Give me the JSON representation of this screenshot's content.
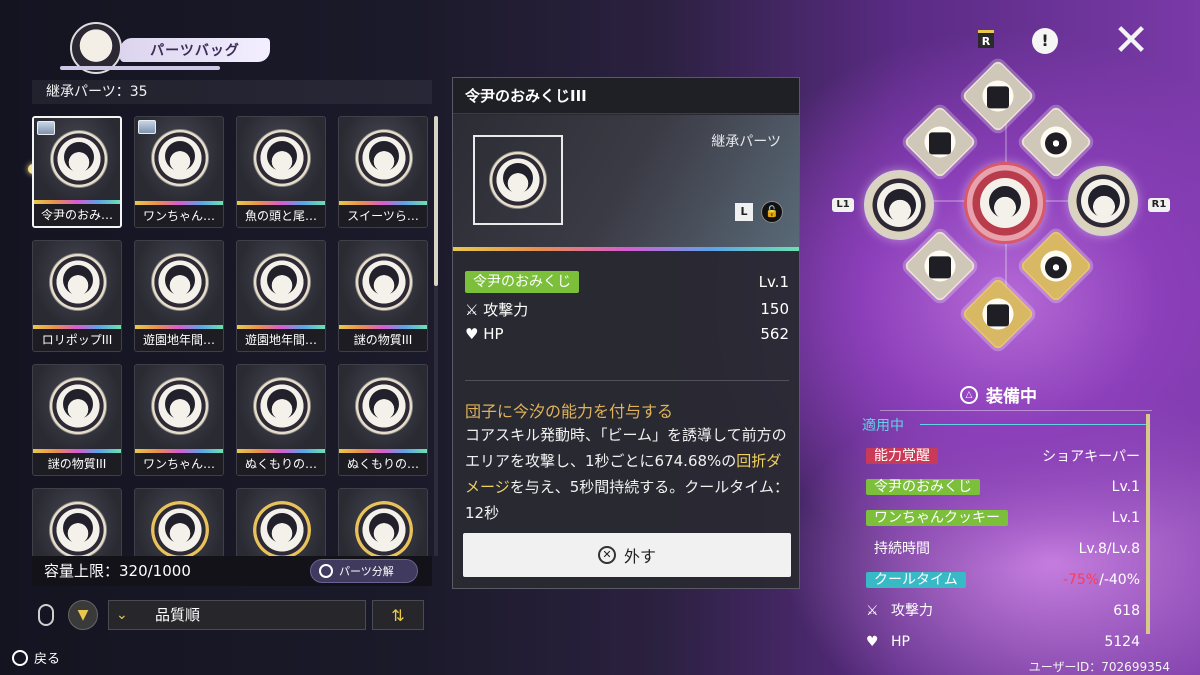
{
  "header": {
    "bag_title": "パーツバッグ",
    "inherit_count": "継承パーツ：35"
  },
  "grid": {
    "items": [
      {
        "label": "令尹のおみ…",
        "selected": true,
        "badge": true,
        "rim": "silver"
      },
      {
        "label": "ワンちゃん…",
        "selected": false,
        "badge": true,
        "rim": "silver"
      },
      {
        "label": "魚の頭と尾…",
        "selected": false,
        "badge": false,
        "rim": "silver"
      },
      {
        "label": "スイーツら…",
        "selected": false,
        "badge": false,
        "rim": "silver"
      },
      {
        "label": "ロリポップIII",
        "selected": false,
        "badge": false,
        "rim": "silver"
      },
      {
        "label": "遊園地年間…",
        "selected": false,
        "badge": false,
        "rim": "silver"
      },
      {
        "label": "遊園地年間…",
        "selected": false,
        "badge": false,
        "rim": "silver"
      },
      {
        "label": "謎の物質III",
        "selected": false,
        "badge": false,
        "rim": "silver"
      },
      {
        "label": "謎の物質III",
        "selected": false,
        "badge": false,
        "rim": "silver"
      },
      {
        "label": "ワンちゃん…",
        "selected": false,
        "badge": false,
        "rim": "silver"
      },
      {
        "label": "ぬくもりの…",
        "selected": false,
        "badge": false,
        "rim": "silver"
      },
      {
        "label": "ぬくもりの…",
        "selected": false,
        "badge": false,
        "rim": "silver"
      },
      {
        "label": "",
        "selected": false,
        "badge": false,
        "rim": "silver"
      },
      {
        "label": "",
        "selected": false,
        "badge": false,
        "rim": "gold"
      },
      {
        "label": "",
        "selected": false,
        "badge": false,
        "rim": "gold"
      },
      {
        "label": "",
        "selected": false,
        "badge": false,
        "rim": "gold"
      }
    ]
  },
  "capacity": {
    "text": "容量上限：320/1000",
    "dismantle_label": "パーツ分解"
  },
  "sort": {
    "field": "品質順",
    "direction_glyph": "⇅",
    "chevron": "⌄",
    "filter_glyph": "▼"
  },
  "nav": {
    "back_label": "戻る"
  },
  "detail": {
    "title": "令尹のおみくじIII",
    "type_label": "継承パーツ",
    "lock_letter": "L",
    "lock_glyph": "🔓",
    "part_tag": "令尹のおみくじ",
    "level": "Lv.1",
    "stats": [
      {
        "icon": "⚔",
        "name": "攻撃力",
        "value": "150"
      },
      {
        "icon": "♥",
        "name": "HP",
        "value": "562"
      }
    ],
    "desc_title": "団子に今汐の能力を付与する",
    "desc_parts": [
      {
        "text": "コアスキル発動時、「ビーム」を誘導して前方のエリアを攻撃し、1秒ごとに674.68%の",
        "hl": false
      },
      {
        "text": "回折ダメージ",
        "hl": true
      },
      {
        "text": "を与え、5秒間持続する。クールタイム：12秒",
        "hl": false
      }
    ],
    "remove_label": "外す",
    "remove_glyph": "✕"
  },
  "wheel": {
    "r_label": "R",
    "info_glyph": "!",
    "close_glyph": "✕",
    "l1_label": "L1",
    "r1_label": "R1"
  },
  "equipped": {
    "header": "装備中",
    "header_glyph": "△",
    "applied_label": "適用中",
    "rows": [
      {
        "tag": "能力覚醒",
        "tag_color": "red",
        "value": "ショアキーパー"
      },
      {
        "tag": "令尹のおみくじ",
        "tag_color": "green",
        "value": "Lv.1"
      },
      {
        "tag": "ワンちゃんクッキー",
        "tag_color": "green",
        "value": "Lv.1"
      },
      {
        "tag": "持続時間",
        "tag_color": "none",
        "value": "Lv.8/Lv.8"
      },
      {
        "tag": "クールタイム",
        "tag_color": "cyan",
        "value_neg": "-75%",
        "value": "/-40%"
      },
      {
        "tag": "攻撃力",
        "tag_color": "none",
        "icon": "⚔",
        "value": "618"
      },
      {
        "tag": "HP",
        "tag_color": "none",
        "icon": "♥",
        "value": "5124"
      }
    ]
  },
  "user": {
    "id_text": "ユーザーID：702699354"
  },
  "colors": {
    "accent_gold": "#e9c94b",
    "tag_green": "#7cbf3a",
    "tag_red": "#c83a58",
    "tag_cyan": "#39b9c5",
    "negative": "#ff3b55",
    "highlight": "#f0d060"
  }
}
